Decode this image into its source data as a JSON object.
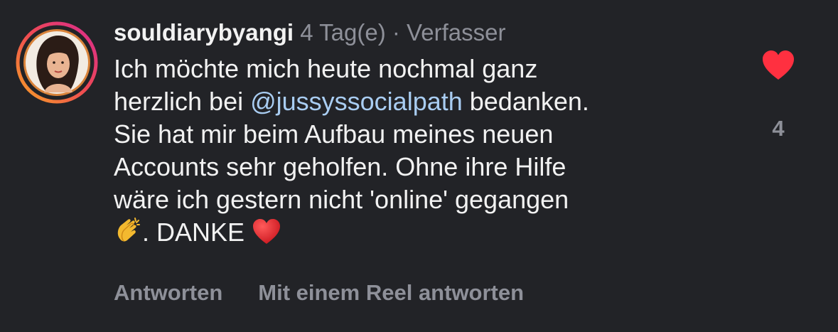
{
  "comment": {
    "username": "souldiarybyangi",
    "time": "4 Tag(e)",
    "separator": "·",
    "author_tag": "Verfasser",
    "text_part1": "Ich möchte mich heute nochmal ganz\nherzlich bei ",
    "mention": "@jussyssocialpath",
    "text_part2": " bedanken.\nSie hat mir beim Aufbau meines neuen\nAccounts sehr geholfen. Ohne ihre Hilfe\nwäre ich gestern nicht 'online' gegangen\n",
    "text_part3": ". DANKE ",
    "emoji_clap": "clapping-hands-icon",
    "emoji_heart": "red-heart-icon"
  },
  "actions": {
    "reply": "Antworten",
    "reply_reel": "Mit einem Reel antworten"
  },
  "like": {
    "count": "4",
    "icon": "heart-icon",
    "color": "#ff3040",
    "liked": true
  },
  "colors": {
    "background": "#222327",
    "mention": "#a9cdf2",
    "muted": "#8e9099",
    "story_ring_start": "#f7a325",
    "story_ring_end": "#d92b8f"
  }
}
